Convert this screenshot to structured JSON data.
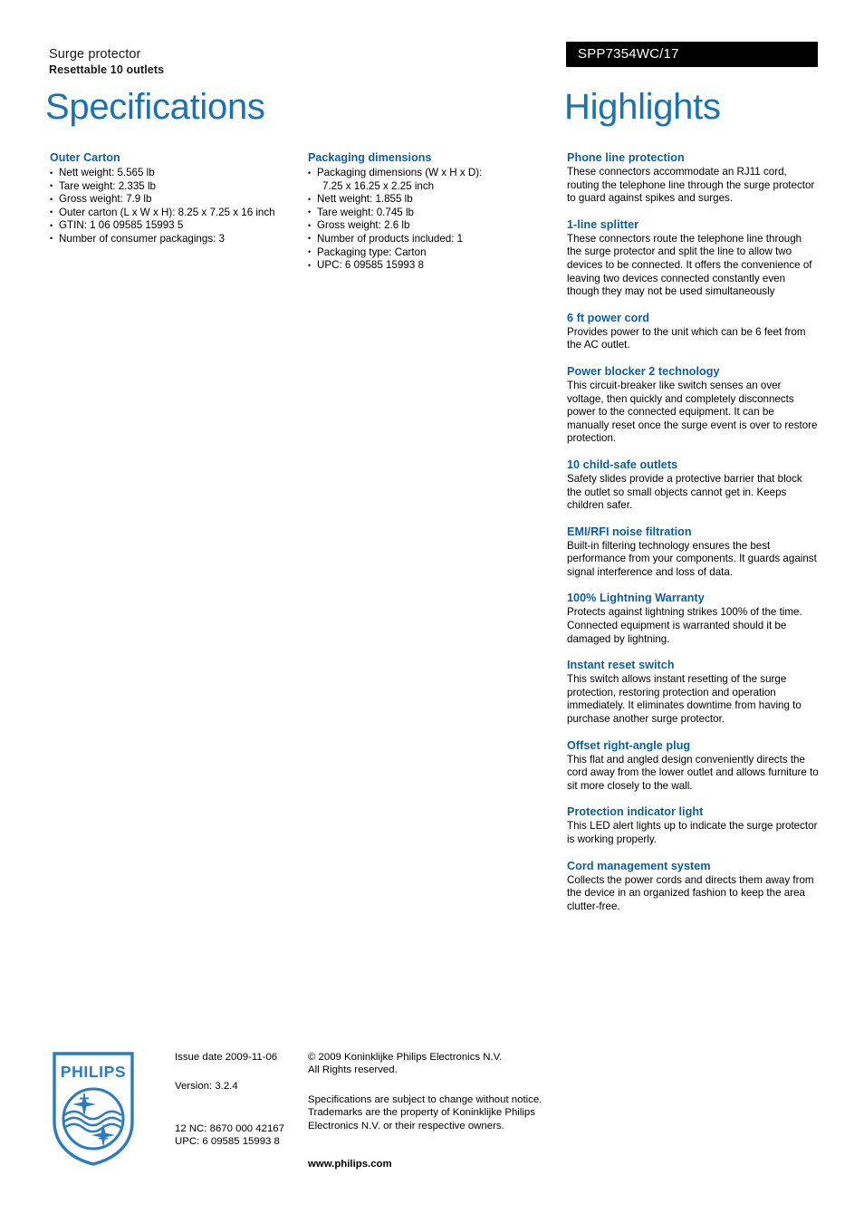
{
  "header": {
    "product_category": "Surge protector",
    "product_subtitle": "Resettable 10 outlets",
    "model_number": "SPP7354WC/17",
    "left_title": "Specifications",
    "right_title": "Highlights",
    "accent_blue": "#0b5e9e",
    "title_blue": "#1b72ae",
    "bar_color": "#000000"
  },
  "specifications": [
    {
      "heading": "Outer Carton",
      "items": [
        {
          "text": "Nett weight: 5.565 lb"
        },
        {
          "text": "Tare weight: 2.335 lb"
        },
        {
          "text": "Gross weight: 7.9 lb"
        },
        {
          "text": "Outer carton (L x W x H): 8.25 x 7.25 x 16 inch"
        },
        {
          "text": "GTIN: 1 06 09585 15993 5"
        },
        {
          "text": "Number of consumer packagings: 3"
        }
      ]
    },
    {
      "heading": "Packaging dimensions",
      "items": [
        {
          "text": "Packaging dimensions (W x H x D):",
          "cont": "7.25 x 16.25 x 2.25 inch"
        },
        {
          "text": "Nett weight: 1.855 lb"
        },
        {
          "text": "Tare weight: 0.745 lb"
        },
        {
          "text": "Gross weight: 2.6 lb"
        },
        {
          "text": "Number of products included: 1"
        },
        {
          "text": "Packaging type: Carton"
        },
        {
          "text": "UPC: 6 09585 15993 8"
        }
      ]
    }
  ],
  "highlights": [
    {
      "heading": "Phone line protection",
      "body": "These connectors accommodate an RJ11 cord, routing the telephone line through the surge protector to guard against spikes and surges."
    },
    {
      "heading": "1-line splitter",
      "body": "These connectors route the telephone line through the surge protector and split the line to allow two devices to be connected. It offers the convenience of leaving two devices connected constantly even though they may not be used simultaneously"
    },
    {
      "heading": "6 ft power cord",
      "body": "Provides power to the unit which can be 6 feet from the AC outlet."
    },
    {
      "heading": "Power blocker 2 technology",
      "body": "This circuit-breaker like switch senses an over voltage, then quickly and completely disconnects power to the connected equipment. It can be manually reset once the surge event is over to restore protection."
    },
    {
      "heading": "10 child-safe outlets",
      "body": "Safety slides provide a protective barrier that block the outlet so small objects cannot get in. Keeps children safer."
    },
    {
      "heading": "EMI/RFI noise filtration",
      "body": "Built-in filtering technology ensures the best performance from your components. It guards against signal interference and loss of data."
    },
    {
      "heading": "100% Lightning Warranty",
      "body": "Protects against lightning strikes 100% of the time. Connected equipment is warranted should it be damaged by lightning."
    },
    {
      "heading": "Instant reset switch",
      "body": "This switch allows instant resetting of the surge protection, restoring protection and operation immediately. It eliminates downtime from having to purchase another surge protector."
    },
    {
      "heading": "Offset right-angle plug",
      "body": "This flat and angled design conveniently directs the cord away from the lower outlet and allows furniture to sit more closely to the wall."
    },
    {
      "heading": "Protection indicator light",
      "body": "This LED alert lights up to indicate the surge protector is working properly."
    },
    {
      "heading": "Cord management system",
      "body": "Collects the power cords and directs them away from the device in an organized fashion to keep the area clutter-free."
    }
  ],
  "footer": {
    "logo_wordmark": "PHILIPS",
    "issue_date": "Issue date 2009-11-06",
    "version": "Version: 3.2.4",
    "nc_code": "12 NC: 8670 000 42167",
    "upc": "UPC: 6 09585 15993 8",
    "copyright_line1": "© 2009 Koninklijke Philips Electronics N.V.",
    "copyright_line2": "All Rights reserved.",
    "disclaimer_line1": "Specifications are subject to change without notice.",
    "disclaimer_line2": "Trademarks are the property of Koninklijke Philips",
    "disclaimer_line3": "Electronics N.V. or their respective owners.",
    "website": "www.philips.com"
  }
}
